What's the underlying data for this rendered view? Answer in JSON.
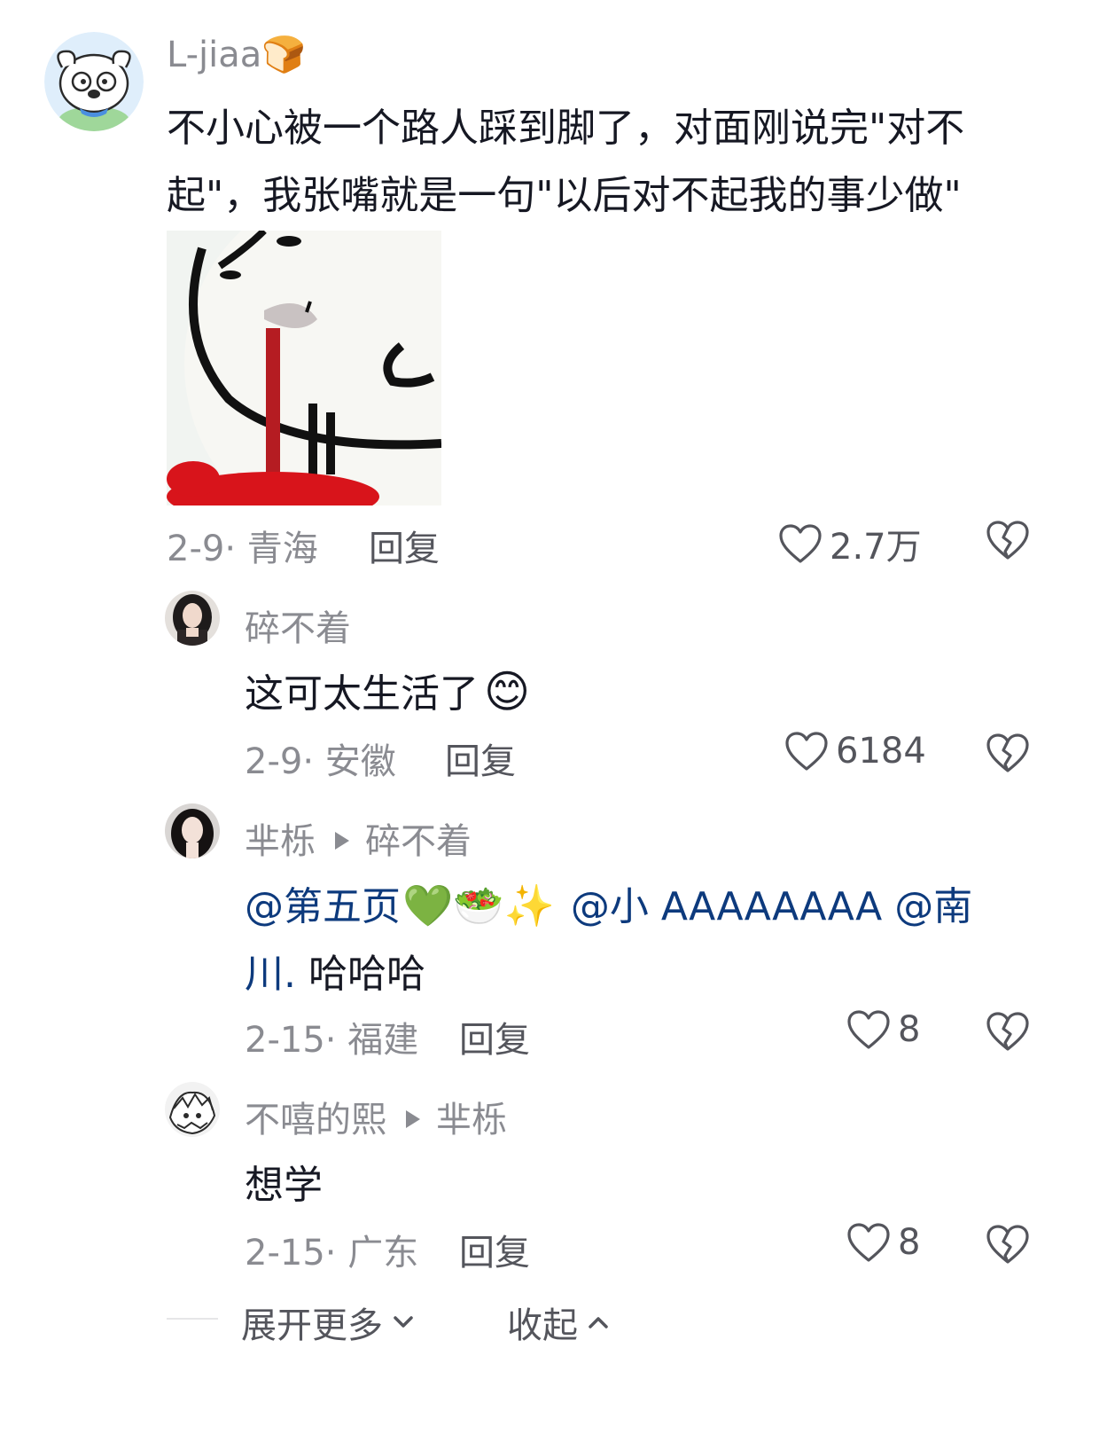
{
  "comments": [
    {
      "username": "L-jiaa",
      "username_emoji": "🍞",
      "text_line1": "不小心被一个路人踩到脚了，对面刚说完\"对不",
      "text_line2": "起\"，我张嘴就是一句\"以后对不起我的事少做\"",
      "date": "2-9",
      "location": "青海",
      "reply_label": "回复",
      "likes": "2.7万"
    },
    {
      "username": "碎不着",
      "text": "这可太生活了",
      "text_emoji": "😊",
      "date": "2-9",
      "location": "安徽",
      "reply_label": "回复",
      "likes": "6184"
    },
    {
      "username": "芈栎",
      "reply_to": "碎不着",
      "mention1": "@第五页",
      "emojis": "💚🥗✨",
      "mention2": "@小 AAAAAAAA",
      "mention3a": "@南",
      "mention3b": "川.",
      "text_tail": "哈哈哈",
      "date": "2-15",
      "location": "福建",
      "reply_label": "回复",
      "likes": "8"
    },
    {
      "username": "不嘻的熙",
      "reply_to": "芈栎",
      "text": "想学",
      "date": "2-15",
      "location": "广东",
      "reply_label": "回复",
      "likes": "8"
    }
  ],
  "footer": {
    "expand_label": "展开更多",
    "collapse_label": "收起"
  },
  "colors": {
    "meta": "#8a8b91",
    "mention": "#0d3a7d",
    "text": "#161823"
  },
  "icons": {
    "like": "heart-outline-icon",
    "dislike": "broken-heart-icon",
    "expand": "chevron-down-icon",
    "collapse": "chevron-up-icon"
  }
}
